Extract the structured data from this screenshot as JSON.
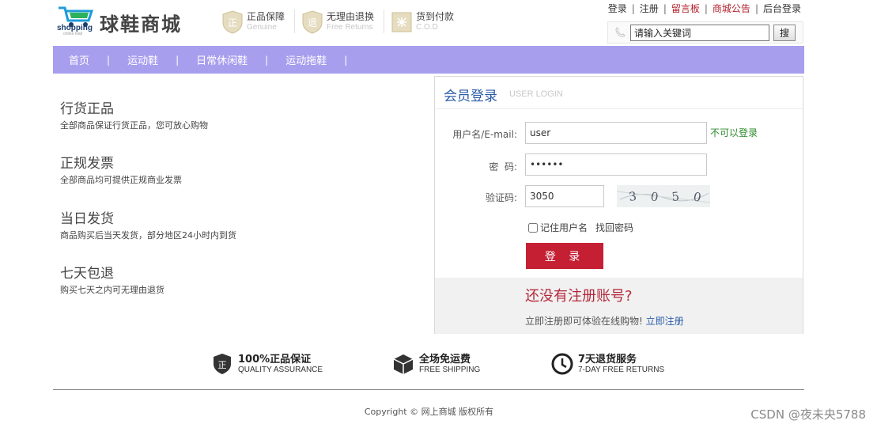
{
  "header": {
    "logo_text": "shopping",
    "logo_sub": "online mall",
    "site_name": "球鞋商城",
    "promises": [
      {
        "cn": "正品保障",
        "en": "Genuine",
        "icon": "shield-zheng-icon"
      },
      {
        "cn": "无理由退换",
        "en": "Free Returns",
        "icon": "shield-tui-icon"
      },
      {
        "cn": "货到付款",
        "en": "C.O.D",
        "icon": "box-icon"
      }
    ],
    "top_links": [
      "登录",
      "注册",
      "留言板",
      "商城公告",
      "后台登录"
    ],
    "search": {
      "value": "请输入关键词",
      "button": "搜"
    }
  },
  "nav": {
    "items": [
      "首页",
      "运动鞋",
      "日常休闲鞋",
      "运动拖鞋"
    ],
    "separator": "|"
  },
  "features": [
    {
      "title": "行货正品",
      "desc": "全部商品保证行货正品，您可放心购物"
    },
    {
      "title": "正规发票",
      "desc": "全部商品均可提供正规商业发票"
    },
    {
      "title": "当日发货",
      "desc": "商品购买后当天发货，部分地区24小时内到货"
    },
    {
      "title": "七天包退",
      "desc": "购买七天之内可无理由退货"
    }
  ],
  "login": {
    "title": "会员登录",
    "title_en": "USER LOGIN",
    "username_label": "用户名/E-mail:",
    "username_value": "user",
    "username_hint": "不可以登录",
    "password_label": "密  码:",
    "password_value": "••••••",
    "captcha_label": "验证码:",
    "captcha_value": "3050",
    "captcha_image_text": "3 0 5 0",
    "remember_label": "记住用户名",
    "find_password": "找回密码",
    "submit": "登 录",
    "no_account": "还没有注册账号?",
    "register_prompt": "立即注册即可体验在线购物!",
    "register_link": "立即注册"
  },
  "services": [
    {
      "cn": "100%正品保证",
      "en": "QUALITY ASSURANCE",
      "icon": "zheng-badge-icon"
    },
    {
      "cn": "全场免运费",
      "en": "FREE SHIPPING",
      "icon": "cube-icon"
    },
    {
      "cn": "7天退货服务",
      "en": "7-DAY FREE RETURNS",
      "icon": "clock-icon"
    }
  ],
  "footer": {
    "copyright": "Copyright © 网上商城 版权所有",
    "watermark": "CSDN @夜未央5788"
  },
  "colors": {
    "nav": "#a79fee",
    "button": "#c51f33",
    "link_blue": "#2b5ca8",
    "accent_red": "#b3283b",
    "hint_green": "#2c8a2c"
  }
}
